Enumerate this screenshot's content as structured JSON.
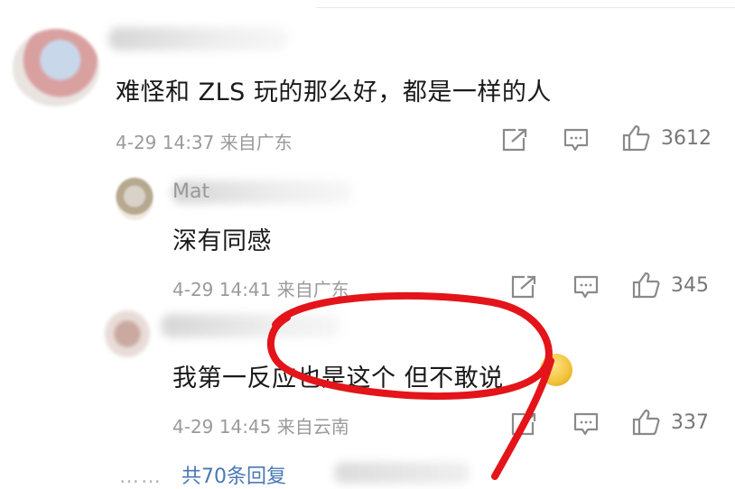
{
  "main_comment": {
    "text": "难怪和 ZLS 玩的那么好，都是一样的人",
    "time": "4-29 14:37",
    "location": "来自广东",
    "likes": "3612"
  },
  "replies": [
    {
      "name": "Mat",
      "text": "深有同感",
      "time": "4-29 14:41",
      "location": "来自广东",
      "likes": "345"
    },
    {
      "text": "我第一反应也是这个 但不敢说",
      "time": "4-29 14:45",
      "location": "来自云南",
      "likes": "337"
    }
  ],
  "more_replies": {
    "dots": "……",
    "label": "共70条回复"
  },
  "icons": {
    "share": "share-icon",
    "comment": "comment-icon",
    "like": "like-icon"
  },
  "colors": {
    "annotation": "#e3141a",
    "link": "#4a78b4",
    "meta": "#9a9a9a"
  }
}
